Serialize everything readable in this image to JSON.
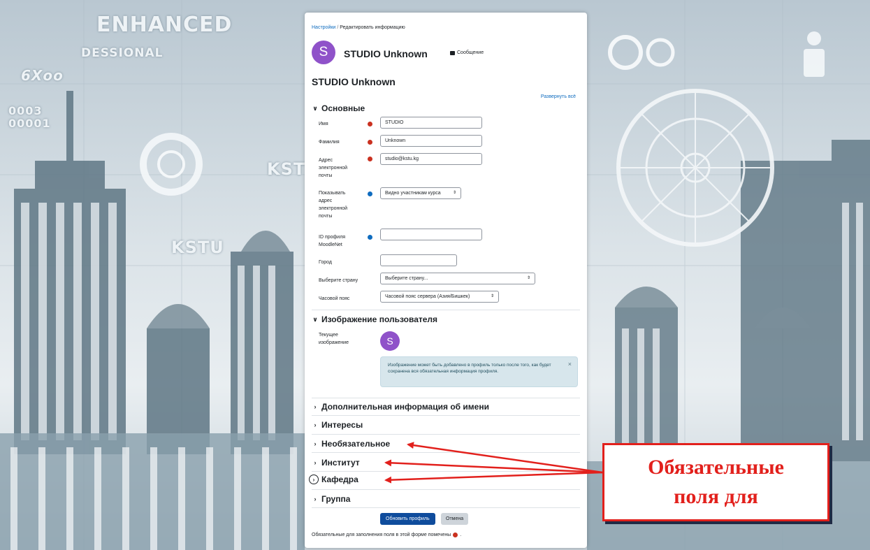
{
  "background": {
    "headline": "ENHANCED",
    "subheadline": "DESSIONAL",
    "brand_right": "KST",
    "brand_left": "KSTU",
    "left_glyphs": "0003\n00001",
    "left_glyphs_2": "6Xoo"
  },
  "breadcrumb": {
    "root": "Настройки",
    "separator": "/",
    "current": "Редактировать информацию"
  },
  "user": {
    "avatar_letter": "S",
    "name": "STUDIO Unknown",
    "message_label": "Сообщение"
  },
  "page_title": "STUDIO Unknown",
  "expand_all_label": "Развернуть всё",
  "sections": {
    "general": "Основные",
    "user_picture": "Изображение пользователя",
    "additional_names": "Дополнительная информация об имени",
    "interests": "Интересы",
    "optional": "Необязательное",
    "institute": "Институт",
    "department": "Кафедра",
    "group": "Группа"
  },
  "fields": {
    "first_name": {
      "label": "Имя",
      "value": "STUDIO"
    },
    "last_name": {
      "label": "Фамилия",
      "value": "Unknown"
    },
    "email": {
      "label": "Адрес электронной почты",
      "value": "studio@kstu.kg"
    },
    "email_display": {
      "label": "Показывать адрес электронной почты",
      "value": "Видно участникам курса"
    },
    "moodlenet": {
      "label": "ID профиля MoodleNet",
      "value": ""
    },
    "city": {
      "label": "Город",
      "value": ""
    },
    "country": {
      "label": "Выберите страну",
      "value": "Выберите страну..."
    },
    "timezone": {
      "label": "Часовой пояс",
      "value": "Часовой пояс сервера (Азия/Бишкек)"
    },
    "current_picture": {
      "label": "Текущее изображение",
      "avatar_letter": "S"
    }
  },
  "alert": {
    "text": "Изображение может быть добавлено в профиль только после того, как будет сохранена вся обязательная информация профиля."
  },
  "buttons": {
    "update": "Обновить профиль",
    "cancel": "Отмена"
  },
  "footnote": "Обязательные для заполнения поля в этой форме помечены",
  "annotation": {
    "line1": "Обязательные",
    "line2": "поля для",
    "color": "#e2201c"
  }
}
